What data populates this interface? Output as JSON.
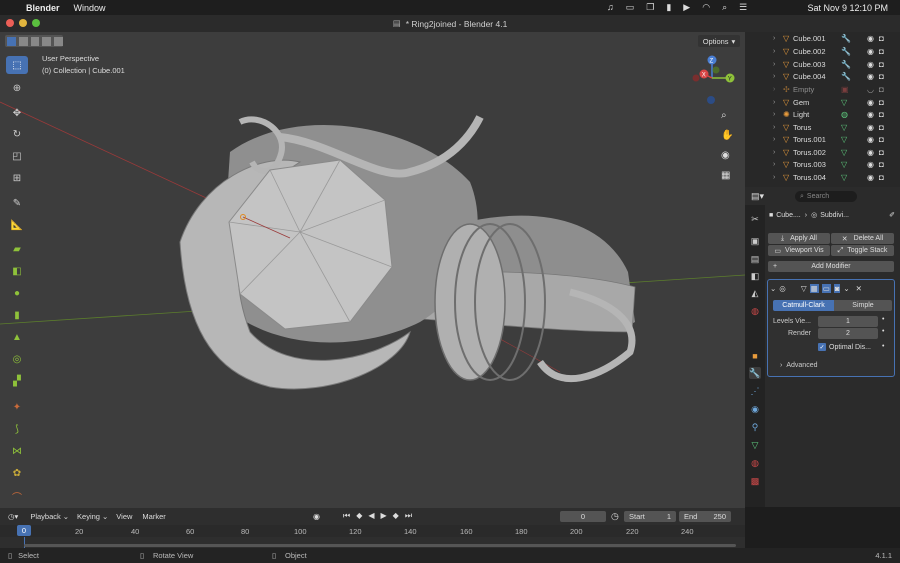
{
  "menubar": {
    "app": "Blender",
    "window": "Window",
    "datetime": "Sat Nov 9  12:10 PM"
  },
  "title": "* Ring2joined - Blender 4.1",
  "viewport": {
    "perspective": "User Perspective",
    "collection": "(0) Collection | Cube.001",
    "options": "Options"
  },
  "outliner": {
    "items": [
      {
        "name": "Cube.001"
      },
      {
        "name": "Cube.002"
      },
      {
        "name": "Cube.003"
      },
      {
        "name": "Cube.004"
      },
      {
        "name": "Empty"
      },
      {
        "name": "Gem"
      },
      {
        "name": "Light"
      },
      {
        "name": "Torus"
      },
      {
        "name": "Torus.001"
      },
      {
        "name": "Torus.002"
      },
      {
        "name": "Torus.003"
      },
      {
        "name": "Torus.004"
      }
    ]
  },
  "properties": {
    "search_placeholder": "Search",
    "object_name": "Cube....",
    "modifier_short": "Subdivi...",
    "apply_all": "Apply All",
    "delete_all": "Delete All",
    "viewport_vis": "Viewport Vis",
    "toggle_stack": "Toggle Stack",
    "add_modifier": "Add Modifier",
    "catmull": "Catmull-Clark",
    "simple": "Simple",
    "levels_label": "Levels Vie...",
    "levels_value": "1",
    "render_label": "Render",
    "render_value": "2",
    "optimal": "Optimal Dis...",
    "advanced": "Advanced"
  },
  "timeline": {
    "playback": "Playback",
    "keying": "Keying",
    "view": "View",
    "marker": "Marker",
    "current_frame": "0",
    "start_label": "Start",
    "start": "1",
    "end_label": "End",
    "end": "250",
    "ticks": [
      "0",
      "20",
      "40",
      "60",
      "80",
      "100",
      "120",
      "140",
      "160",
      "180",
      "200",
      "220",
      "240"
    ]
  },
  "status": {
    "select": "Select",
    "rotate": "Rotate View",
    "object": "Object",
    "version": "4.1.1"
  }
}
